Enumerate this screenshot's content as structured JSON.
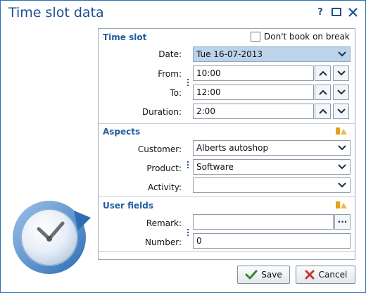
{
  "dialog": {
    "title": "Time slot data",
    "icons": [
      "help-icon",
      "maximize-icon",
      "close-icon"
    ],
    "help_glyph": "?"
  },
  "time_slot": {
    "title": "Time slot",
    "dont_book_label": "Don't book on break",
    "dont_book_checked": false,
    "date_label": "Date:",
    "date_value": "Tue 16-07-2013",
    "from_label": "From:",
    "from_value": "10:00",
    "to_label": "To:",
    "to_value": "12:00",
    "duration_label": "Duration:",
    "duration_value": "2:00"
  },
  "aspects": {
    "title": "Aspects",
    "customer_label": "Customer:",
    "customer_value": "Alberts autoshop",
    "product_label": "Product:",
    "product_value": "Software",
    "activity_label": "Activity:",
    "activity_value": ""
  },
  "user_fields": {
    "title": "User fields",
    "remark_label": "Remark:",
    "remark_value": "",
    "number_label": "Number:",
    "number_value": "0"
  },
  "buttons": {
    "save_label": "Save",
    "cancel_label": "Cancel",
    "ellipsis_label": "···"
  },
  "colors": {
    "title": "#1e4f91",
    "section": "#1f5f9e",
    "selected_field": "#bcd3ea",
    "save_check": "#2e8b2e",
    "cancel_x": "#c0392b"
  }
}
